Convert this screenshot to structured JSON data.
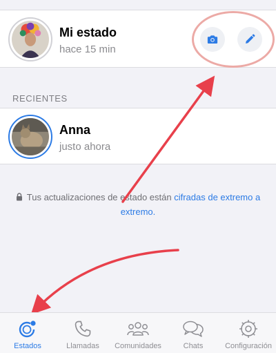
{
  "my_status": {
    "name": "Mi estado",
    "time": "hace 15 min",
    "camera_icon": "camera-icon",
    "pencil_icon": "pencil-icon"
  },
  "section": {
    "recent_header": "RECIENTES"
  },
  "contacts": [
    {
      "name": "Anna",
      "time": "justo ahora"
    }
  ],
  "encryption": {
    "text": "Tus actualizaciones de estado están ",
    "link": "cifradas de extremo a extremo",
    "end": "."
  },
  "tabs": [
    {
      "label": "Estados",
      "icon": "status-icon",
      "active": true
    },
    {
      "label": "Llamadas",
      "icon": "phone-icon",
      "active": false
    },
    {
      "label": "Comunidades",
      "icon": "communities-icon",
      "active": false
    },
    {
      "label": "Chats",
      "icon": "chats-icon",
      "active": false
    },
    {
      "label": "Configuración",
      "icon": "settings-icon",
      "active": false
    }
  ],
  "colors": {
    "accent": "#2c7be5",
    "annotation_red": "#e8404b",
    "highlight_oval": "#ecaaa6",
    "background": "#f2f2f7"
  }
}
